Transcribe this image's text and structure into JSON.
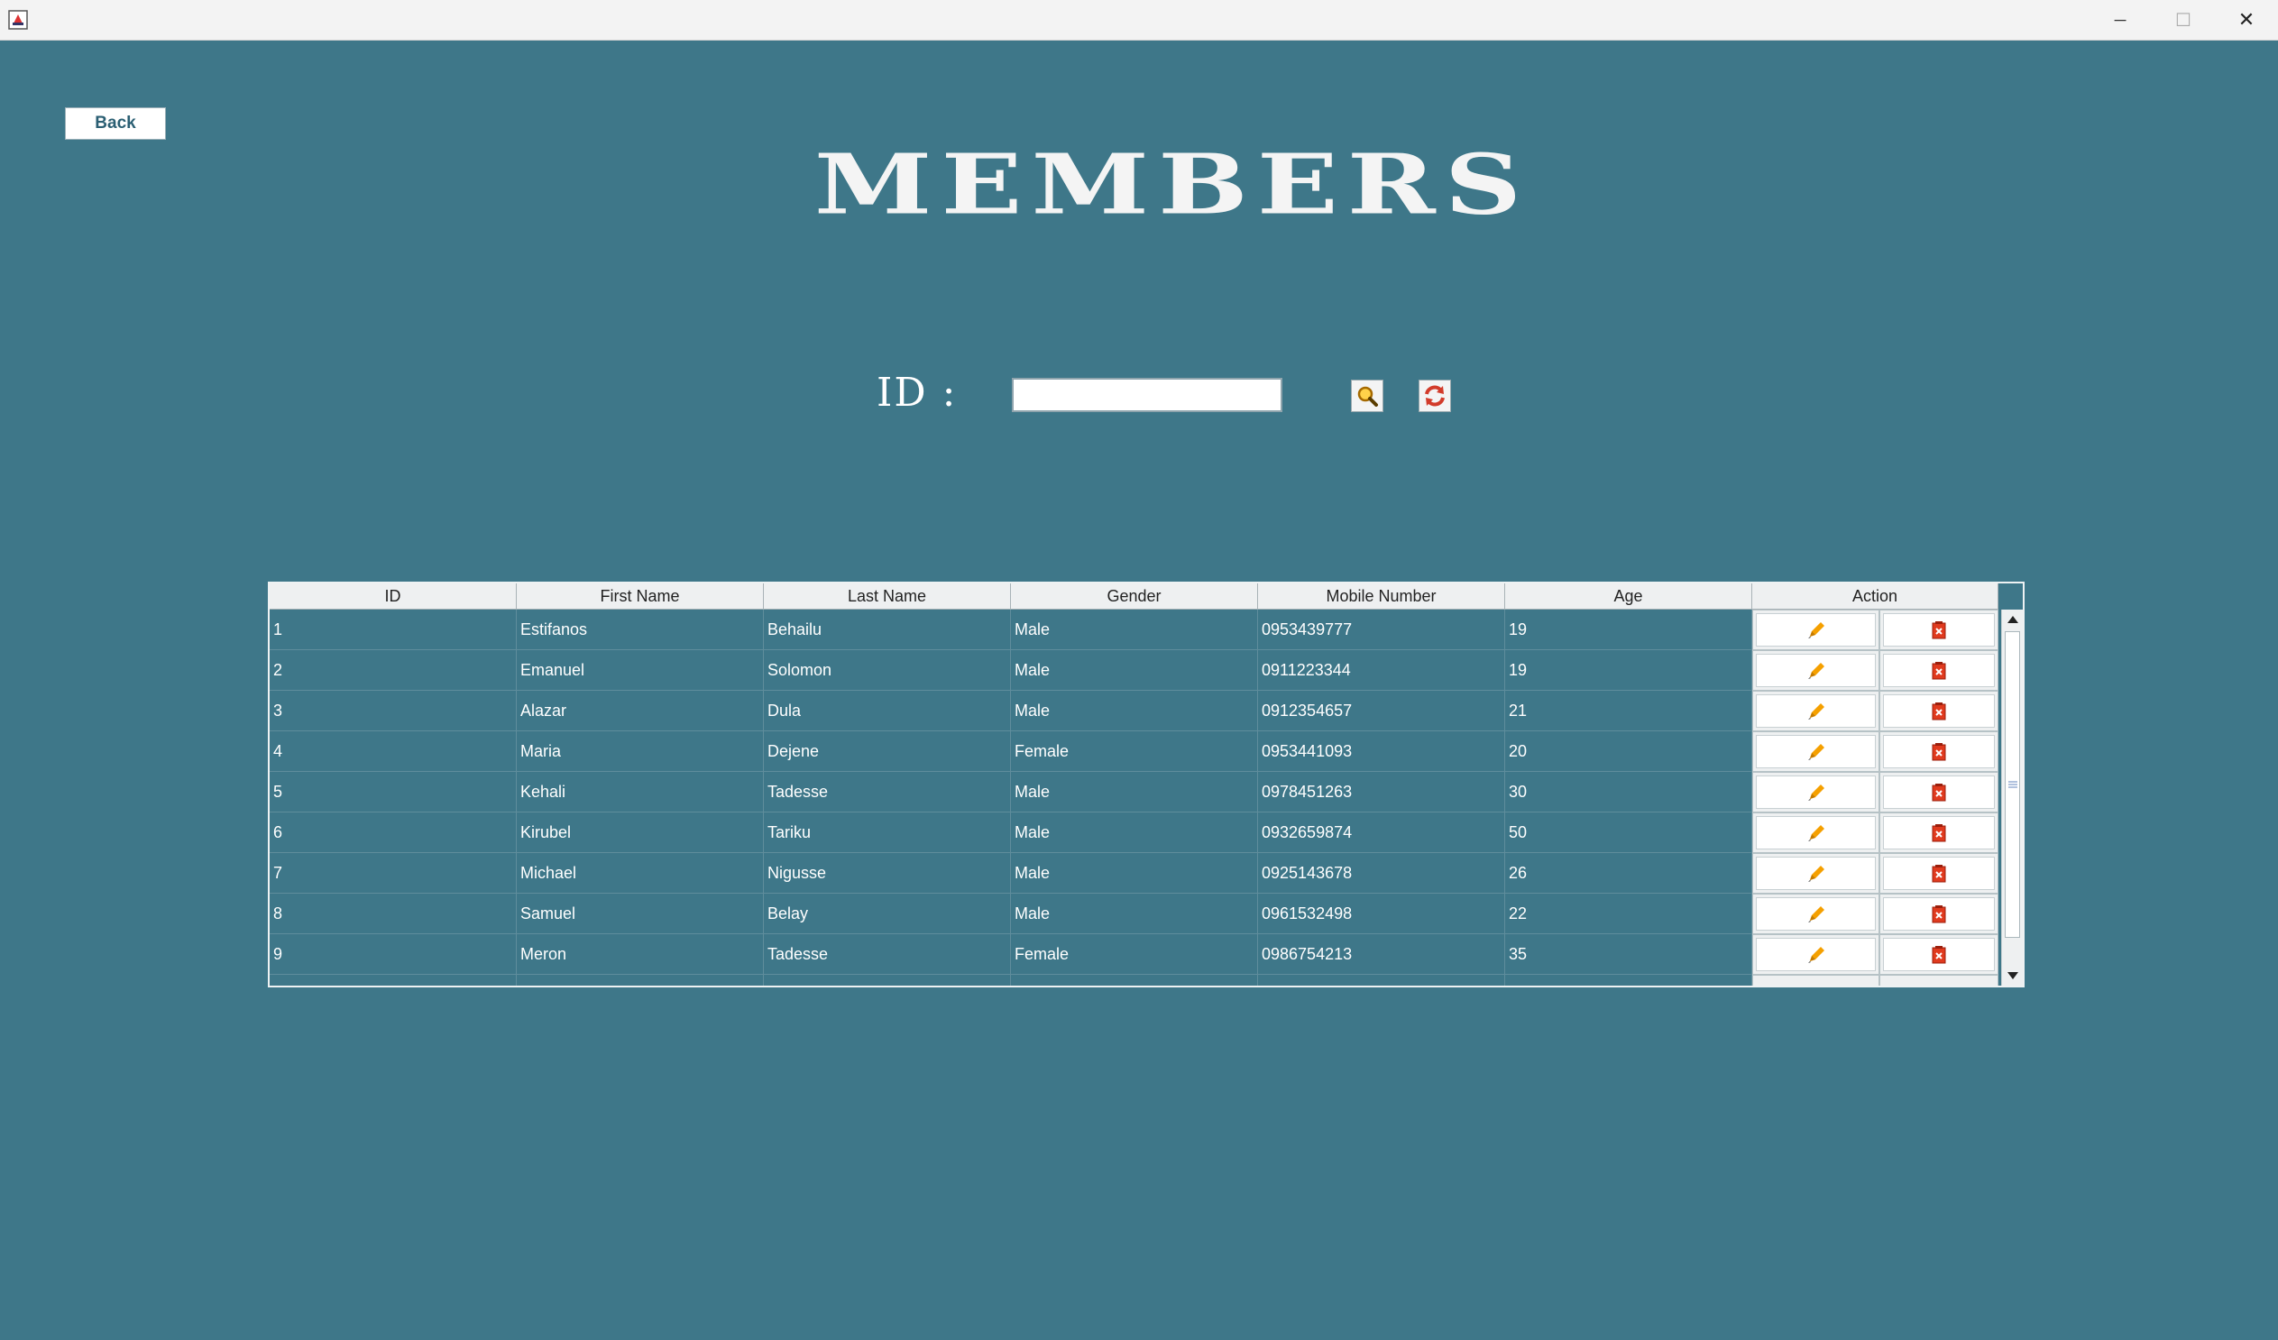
{
  "window": {
    "minimize_glyph": "─",
    "maximize_glyph": "☐",
    "close_glyph": "✕"
  },
  "back_label": "Back",
  "title": "MEMBERS",
  "search": {
    "label": "ID :",
    "value": "",
    "search_icon": "magnifier-icon",
    "refresh_icon": "refresh-icon"
  },
  "table": {
    "headers": [
      "ID",
      "First Name",
      "Last Name",
      "Gender",
      "Mobile Number",
      "Age",
      "Action"
    ],
    "rows": [
      {
        "id": "1",
        "first": "Estifanos",
        "last": "Behailu",
        "gender": "Male",
        "mobile": "0953439777",
        "age": "19"
      },
      {
        "id": "2",
        "first": "Emanuel",
        "last": "Solomon",
        "gender": "Male",
        "mobile": "0911223344",
        "age": "19"
      },
      {
        "id": "3",
        "first": "Alazar",
        "last": "Dula",
        "gender": "Male",
        "mobile": "0912354657",
        "age": "21"
      },
      {
        "id": "4",
        "first": "Maria",
        "last": "Dejene",
        "gender": "Female",
        "mobile": "0953441093",
        "age": "20"
      },
      {
        "id": "5",
        "first": "Kehali",
        "last": "Tadesse",
        "gender": "Male",
        "mobile": "0978451263",
        "age": "30"
      },
      {
        "id": "6",
        "first": "Kirubel",
        "last": "Tariku",
        "gender": "Male",
        "mobile": "0932659874",
        "age": "50"
      },
      {
        "id": "7",
        "first": "Michael",
        "last": "Nigusse",
        "gender": "Male",
        "mobile": "0925143678",
        "age": "26"
      },
      {
        "id": "8",
        "first": "Samuel",
        "last": "Belay",
        "gender": "Male",
        "mobile": "0961532498",
        "age": "22"
      },
      {
        "id": "9",
        "first": "Meron",
        "last": "Tadesse",
        "gender": "Female",
        "mobile": "0986754213",
        "age": "35"
      }
    ],
    "action_icons": {
      "edit": "pencil-icon",
      "delete": "delete-icon"
    }
  },
  "colors": {
    "background": "#3e7789",
    "edit_icon": "#f5a000",
    "delete_icon": "#e03a1e"
  }
}
